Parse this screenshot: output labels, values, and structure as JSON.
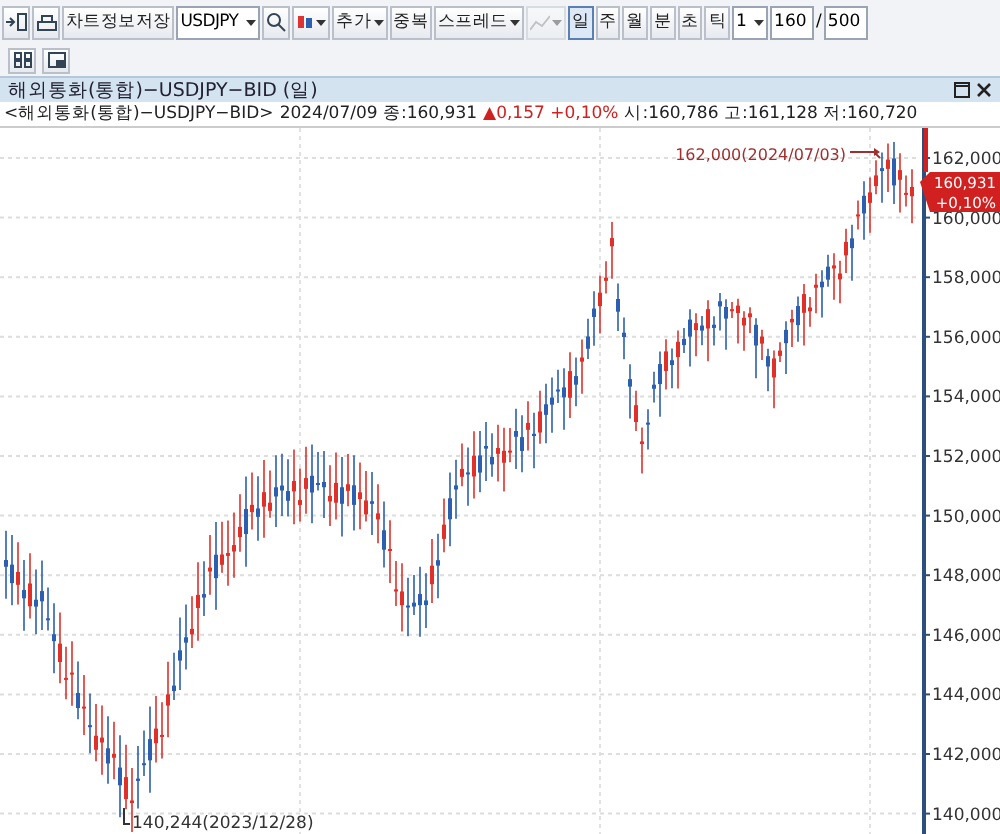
{
  "toolbar": {
    "save_button": "차트정보저장",
    "symbol": "USDJPY",
    "add_menu": "추가",
    "overlap_button": "중복",
    "spread_menu": "스프레드",
    "periods": [
      {
        "label": "일",
        "selected": true
      },
      {
        "label": "주",
        "selected": false
      },
      {
        "label": "월",
        "selected": false
      },
      {
        "label": "분",
        "selected": false
      },
      {
        "label": "초",
        "selected": false
      },
      {
        "label": "틱",
        "selected": false
      }
    ],
    "interval": "1",
    "count": "160",
    "separator": "/",
    "total": "500"
  },
  "panel": {
    "title": "해외통화(통합)−USDJPY−BID (일)"
  },
  "info": {
    "name": "<해외통화(통합)−USDJPY−BID>",
    "date_close": "2024/07/09 종:160,931",
    "change": "▲0,157 +0,10%",
    "ohl": "시:160,786 고:161,128 저:160,720"
  },
  "chart": {
    "yticks": [
      "162,000",
      "160,000",
      "158,000",
      "156,000",
      "154,000",
      "152,000",
      "150,000",
      "148,000",
      "146,000",
      "144,000",
      "142,000",
      "140,000"
    ],
    "high_label": "162,000(2024/07/03)",
    "low_label": "140,244(2023/12/28)",
    "last_price": "160,931",
    "last_change": "+0,10%"
  }
}
